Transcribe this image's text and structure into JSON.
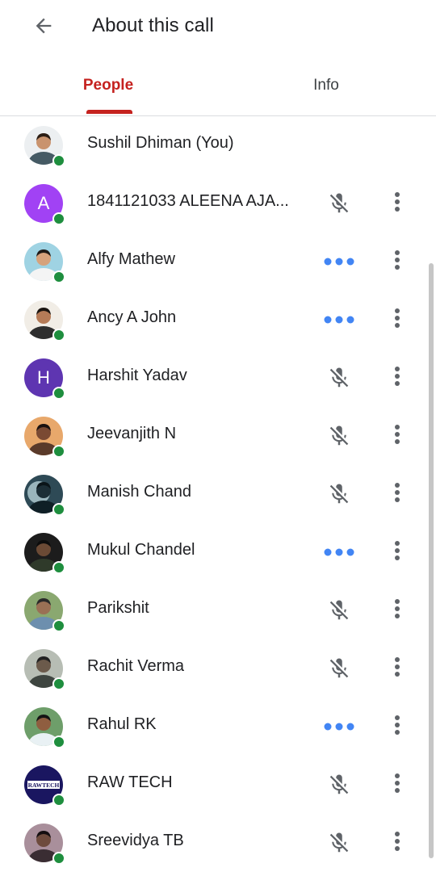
{
  "header": {
    "title": "About this call",
    "back_icon": "arrow-back-icon"
  },
  "tabs": [
    {
      "label": "People",
      "selected": true
    },
    {
      "label": "Info",
      "selected": false
    }
  ],
  "colors": {
    "accent": "#c5221f",
    "presence": "#1e8e3e",
    "speaking": "#4285f4",
    "icon": "#5f6368"
  },
  "participants": [
    {
      "name": "Sushil Dhiman (You)",
      "avatar": "photo",
      "status": "none"
    },
    {
      "name": "1841121033 ALEENA AJA...",
      "avatar": "letter",
      "initial": "A",
      "avatar_color": "#a142f4",
      "status": "muted"
    },
    {
      "name": "Alfy Mathew",
      "avatar": "photo",
      "status": "speaking"
    },
    {
      "name": "Ancy A John",
      "avatar": "photo",
      "status": "speaking"
    },
    {
      "name": "Harshit Yadav",
      "avatar": "letter",
      "initial": "H",
      "avatar_color": "#5e35b1",
      "status": "muted"
    },
    {
      "name": "Jeevanjith N",
      "avatar": "photo",
      "status": "muted"
    },
    {
      "name": "Manish Chand",
      "avatar": "photo",
      "status": "muted"
    },
    {
      "name": "Mukul Chandel",
      "avatar": "photo",
      "status": "speaking"
    },
    {
      "name": "Parikshit",
      "avatar": "photo",
      "status": "muted"
    },
    {
      "name": "Rachit Verma",
      "avatar": "photo",
      "status": "muted"
    },
    {
      "name": "Rahul RK",
      "avatar": "photo",
      "status": "speaking"
    },
    {
      "name": "RAW TECH",
      "avatar": "logo",
      "logo_text": "RAWTECH",
      "status": "muted"
    },
    {
      "name": "Sreevidya TB",
      "avatar": "photo",
      "status": "muted"
    }
  ]
}
